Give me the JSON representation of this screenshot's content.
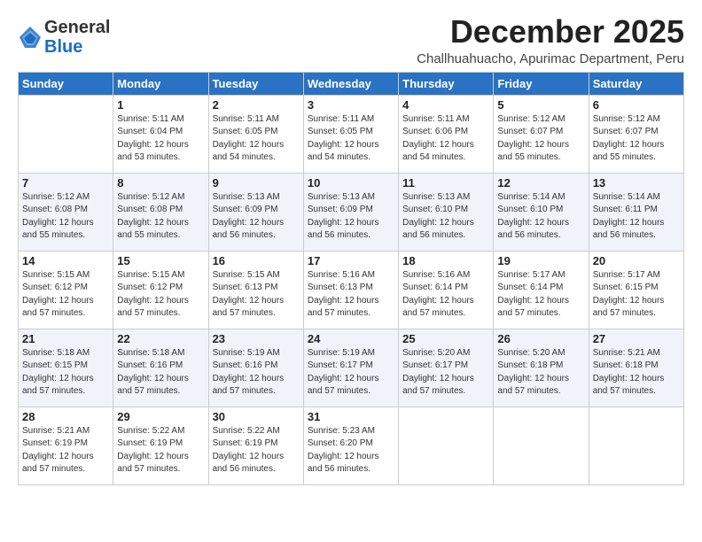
{
  "logo": {
    "line1": "General",
    "line2": "Blue"
  },
  "title": "December 2025",
  "subtitle": "Challhuahuacho, Apurimac Department, Peru",
  "weekdays": [
    "Sunday",
    "Monday",
    "Tuesday",
    "Wednesday",
    "Thursday",
    "Friday",
    "Saturday"
  ],
  "weeks": [
    [
      {
        "day": "",
        "info": ""
      },
      {
        "day": "1",
        "info": "Sunrise: 5:11 AM\nSunset: 6:04 PM\nDaylight: 12 hours\nand 53 minutes."
      },
      {
        "day": "2",
        "info": "Sunrise: 5:11 AM\nSunset: 6:05 PM\nDaylight: 12 hours\nand 54 minutes."
      },
      {
        "day": "3",
        "info": "Sunrise: 5:11 AM\nSunset: 6:05 PM\nDaylight: 12 hours\nand 54 minutes."
      },
      {
        "day": "4",
        "info": "Sunrise: 5:11 AM\nSunset: 6:06 PM\nDaylight: 12 hours\nand 54 minutes."
      },
      {
        "day": "5",
        "info": "Sunrise: 5:12 AM\nSunset: 6:07 PM\nDaylight: 12 hours\nand 55 minutes."
      },
      {
        "day": "6",
        "info": "Sunrise: 5:12 AM\nSunset: 6:07 PM\nDaylight: 12 hours\nand 55 minutes."
      }
    ],
    [
      {
        "day": "7",
        "info": "Sunrise: 5:12 AM\nSunset: 6:08 PM\nDaylight: 12 hours\nand 55 minutes."
      },
      {
        "day": "8",
        "info": "Sunrise: 5:12 AM\nSunset: 6:08 PM\nDaylight: 12 hours\nand 55 minutes."
      },
      {
        "day": "9",
        "info": "Sunrise: 5:13 AM\nSunset: 6:09 PM\nDaylight: 12 hours\nand 56 minutes."
      },
      {
        "day": "10",
        "info": "Sunrise: 5:13 AM\nSunset: 6:09 PM\nDaylight: 12 hours\nand 56 minutes."
      },
      {
        "day": "11",
        "info": "Sunrise: 5:13 AM\nSunset: 6:10 PM\nDaylight: 12 hours\nand 56 minutes."
      },
      {
        "day": "12",
        "info": "Sunrise: 5:14 AM\nSunset: 6:10 PM\nDaylight: 12 hours\nand 56 minutes."
      },
      {
        "day": "13",
        "info": "Sunrise: 5:14 AM\nSunset: 6:11 PM\nDaylight: 12 hours\nand 56 minutes."
      }
    ],
    [
      {
        "day": "14",
        "info": "Sunrise: 5:15 AM\nSunset: 6:12 PM\nDaylight: 12 hours\nand 57 minutes."
      },
      {
        "day": "15",
        "info": "Sunrise: 5:15 AM\nSunset: 6:12 PM\nDaylight: 12 hours\nand 57 minutes."
      },
      {
        "day": "16",
        "info": "Sunrise: 5:15 AM\nSunset: 6:13 PM\nDaylight: 12 hours\nand 57 minutes."
      },
      {
        "day": "17",
        "info": "Sunrise: 5:16 AM\nSunset: 6:13 PM\nDaylight: 12 hours\nand 57 minutes."
      },
      {
        "day": "18",
        "info": "Sunrise: 5:16 AM\nSunset: 6:14 PM\nDaylight: 12 hours\nand 57 minutes."
      },
      {
        "day": "19",
        "info": "Sunrise: 5:17 AM\nSunset: 6:14 PM\nDaylight: 12 hours\nand 57 minutes."
      },
      {
        "day": "20",
        "info": "Sunrise: 5:17 AM\nSunset: 6:15 PM\nDaylight: 12 hours\nand 57 minutes."
      }
    ],
    [
      {
        "day": "21",
        "info": "Sunrise: 5:18 AM\nSunset: 6:15 PM\nDaylight: 12 hours\nand 57 minutes."
      },
      {
        "day": "22",
        "info": "Sunrise: 5:18 AM\nSunset: 6:16 PM\nDaylight: 12 hours\nand 57 minutes."
      },
      {
        "day": "23",
        "info": "Sunrise: 5:19 AM\nSunset: 6:16 PM\nDaylight: 12 hours\nand 57 minutes."
      },
      {
        "day": "24",
        "info": "Sunrise: 5:19 AM\nSunset: 6:17 PM\nDaylight: 12 hours\nand 57 minutes."
      },
      {
        "day": "25",
        "info": "Sunrise: 5:20 AM\nSunset: 6:17 PM\nDaylight: 12 hours\nand 57 minutes."
      },
      {
        "day": "26",
        "info": "Sunrise: 5:20 AM\nSunset: 6:18 PM\nDaylight: 12 hours\nand 57 minutes."
      },
      {
        "day": "27",
        "info": "Sunrise: 5:21 AM\nSunset: 6:18 PM\nDaylight: 12 hours\nand 57 minutes."
      }
    ],
    [
      {
        "day": "28",
        "info": "Sunrise: 5:21 AM\nSunset: 6:19 PM\nDaylight: 12 hours\nand 57 minutes."
      },
      {
        "day": "29",
        "info": "Sunrise: 5:22 AM\nSunset: 6:19 PM\nDaylight: 12 hours\nand 57 minutes."
      },
      {
        "day": "30",
        "info": "Sunrise: 5:22 AM\nSunset: 6:19 PM\nDaylight: 12 hours\nand 56 minutes."
      },
      {
        "day": "31",
        "info": "Sunrise: 5:23 AM\nSunset: 6:20 PM\nDaylight: 12 hours\nand 56 minutes."
      },
      {
        "day": "",
        "info": ""
      },
      {
        "day": "",
        "info": ""
      },
      {
        "day": "",
        "info": ""
      }
    ]
  ]
}
